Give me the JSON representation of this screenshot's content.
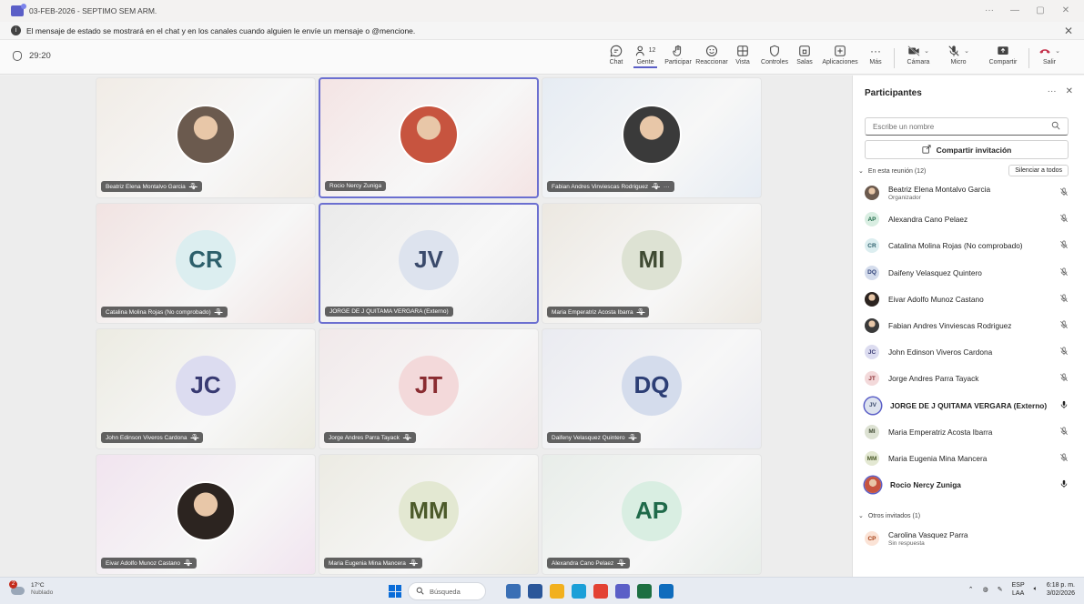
{
  "window": {
    "title": "03-FEB-2026 - SEPTIMO SEM ARM.",
    "controls": [
      "···",
      "—",
      "▢",
      "✕"
    ]
  },
  "notification": {
    "icon": "info-icon",
    "message": "El mensaje de estado se mostrará en el chat y en los canales cuando alguien le envíe un mensaje o @mencione.",
    "close": "✕"
  },
  "toolbar": {
    "timer": "29:20",
    "people_count": "12",
    "buttons": {
      "chat": "Chat",
      "people": "Gente",
      "raise": "Participar",
      "react": "Reaccionar",
      "view": "Vista",
      "controls": "Controles",
      "rooms": "Salas",
      "apps": "Aplicaciones",
      "more": "Más",
      "camera": "Cámara",
      "mic": "Micro",
      "share": "Compartir",
      "leave": "Salir"
    }
  },
  "tiles": [
    {
      "name": "Beatriz Elena Montalvo Garcia",
      "initials": "",
      "photo": true,
      "muted": true,
      "bg": "#f1ece6",
      "avatar_color": "#6b5a4e"
    },
    {
      "name": "Rocio Nercy Zuniga",
      "initials": "",
      "photo": true,
      "muted": false,
      "bg": "#f4e4e4",
      "avatar_color": "#c7543f"
    },
    {
      "name": "Fabian Andres Vinviescas Rodriguez",
      "initials": "",
      "photo": true,
      "muted": true,
      "bg": "#e6ecf3",
      "avatar_color": "#3a3a3a"
    },
    {
      "name": "Catalina Molina Rojas (No comprobado)",
      "initials": "CR",
      "photo": false,
      "muted": true,
      "bg": "#f1e3e2",
      "avatar_color": "#dceef0",
      "text_color": "#2d5f6b"
    },
    {
      "name": "JORGE DE J QUITAMA VERGARA (Externo)",
      "initials": "JV",
      "photo": false,
      "muted": false,
      "bg": "#eaeaea",
      "avatar_color": "#dde3ee",
      "text_color": "#3a4a6b"
    },
    {
      "name": "Maria Emperatriz Acosta Ibarra",
      "initials": "MI",
      "photo": false,
      "muted": true,
      "bg": "#ece8e1",
      "avatar_color": "#dde2d3",
      "text_color": "#3f4a32"
    },
    {
      "name": "John Edinson Viveros Cardona",
      "initials": "JC",
      "photo": false,
      "muted": true,
      "bg": "#ecebe2",
      "avatar_color": "#dcdcf0",
      "text_color": "#383a72"
    },
    {
      "name": "Jorge Andres Parra Tayack",
      "initials": "JT",
      "photo": false,
      "muted": true,
      "bg": "#f1e9ea",
      "avatar_color": "#f3d9da",
      "text_color": "#8a2c31"
    },
    {
      "name": "Daifeny Velasquez Quintero",
      "initials": "DQ",
      "photo": false,
      "muted": true,
      "bg": "#eaebf1",
      "avatar_color": "#d4dcec",
      "text_color": "#2c3e75"
    },
    {
      "name": "Eivar Adolfo Munoz Castano",
      "initials": "",
      "photo": true,
      "muted": true,
      "bg": "#f1e4ef",
      "avatar_color": "#2c2420"
    },
    {
      "name": "Maria Eugenia Mina Mancera",
      "initials": "MM",
      "photo": false,
      "muted": true,
      "bg": "#ecebe3",
      "avatar_color": "#e3e8d2",
      "text_color": "#4c5a2a"
    },
    {
      "name": "Alexandra Cano Pelaez",
      "initials": "AP",
      "photo": false,
      "muted": true,
      "bg": "#e8ede9",
      "avatar_color": "#d9eee2",
      "text_color": "#1f6a4a"
    }
  ],
  "panel": {
    "title": "Participantes",
    "more": "···",
    "close": "✕",
    "search_placeholder": "Escribe un nombre",
    "share_invite": "Compartir invitación",
    "in_meeting_label": "En esta reunión (12)",
    "mute_all": "Silenciar a todos",
    "participants": [
      {
        "name": "Beatriz Elena Montalvo Garcia",
        "sub": "Organizador",
        "initials": "",
        "photo": true,
        "avatar_bg": "#6b5a4e",
        "avatar_fg": "#fff",
        "muted": true,
        "bold": false
      },
      {
        "name": "Alexandra Cano Pelaez",
        "sub": "",
        "initials": "AP",
        "photo": false,
        "avatar_bg": "#d9eee2",
        "avatar_fg": "#1f6a4a",
        "muted": true,
        "bold": false
      },
      {
        "name": "Catalina Molina Rojas (No comprobado)",
        "sub": "",
        "initials": "CR",
        "photo": false,
        "avatar_bg": "#dceef0",
        "avatar_fg": "#2d5f6b",
        "muted": true,
        "bold": false
      },
      {
        "name": "Daifeny Velasquez Quintero",
        "sub": "",
        "initials": "DQ",
        "photo": false,
        "avatar_bg": "#d4dcec",
        "avatar_fg": "#2c3e75",
        "muted": true,
        "bold": false
      },
      {
        "name": "Eivar Adolfo Munoz Castano",
        "sub": "",
        "initials": "",
        "photo": true,
        "avatar_bg": "#2c2420",
        "avatar_fg": "#fff",
        "muted": true,
        "bold": false
      },
      {
        "name": "Fabian Andres Vinviescas Rodriguez",
        "sub": "",
        "initials": "",
        "photo": true,
        "avatar_bg": "#3a3a3a",
        "avatar_fg": "#fff",
        "muted": true,
        "bold": false
      },
      {
        "name": "John Edinson Viveros Cardona",
        "sub": "",
        "initials": "JC",
        "photo": false,
        "avatar_bg": "#dcdcf0",
        "avatar_fg": "#383a72",
        "muted": true,
        "bold": false
      },
      {
        "name": "Jorge Andres Parra Tayack",
        "sub": "",
        "initials": "JT",
        "photo": false,
        "avatar_bg": "#f3d9da",
        "avatar_fg": "#8a2c31",
        "muted": true,
        "bold": false
      },
      {
        "name": "JORGE DE J QUITAMA VERGARA (Externo)",
        "sub": "",
        "initials": "JV",
        "photo": false,
        "avatar_bg": "#dde3ee",
        "avatar_fg": "#3a4a6b",
        "muted": false,
        "bold": true
      },
      {
        "name": "Maria Emperatriz Acosta Ibarra",
        "sub": "",
        "initials": "MI",
        "photo": false,
        "avatar_bg": "#dde2d3",
        "avatar_fg": "#3f4a32",
        "muted": true,
        "bold": false
      },
      {
        "name": "Maria Eugenia Mina Mancera",
        "sub": "",
        "initials": "MM",
        "photo": false,
        "avatar_bg": "#e3e8d2",
        "avatar_fg": "#4c5a2a",
        "muted": true,
        "bold": false
      },
      {
        "name": "Rocio Nercy Zuniga",
        "sub": "",
        "initials": "",
        "photo": true,
        "avatar_bg": "#c7543f",
        "avatar_fg": "#fff",
        "muted": false,
        "bold": true
      }
    ],
    "others_label": "Otros invitados (1)",
    "others": [
      {
        "name": "Carolina Vasquez Parra",
        "sub": "Sin respuesta",
        "initials": "CP",
        "avatar_bg": "#fbe3d6",
        "avatar_fg": "#a33a0f"
      }
    ]
  },
  "taskbar": {
    "weather_temp": "17°C",
    "weather_desc": "Nublado",
    "weather_badge": "2",
    "search": "Búsqueda",
    "lang_top": "ESP",
    "lang_bottom": "LAA",
    "time": "6:18 p. m.",
    "date": "3/02/2026",
    "apps": [
      {
        "name": "files-app-icon",
        "color": "#3a6fb5"
      },
      {
        "name": "store-app-icon",
        "color": "#2b579a"
      },
      {
        "name": "explorer-app-icon",
        "color": "#f2b01e"
      },
      {
        "name": "edge-app-icon",
        "color": "#1b9fd8"
      },
      {
        "name": "chrome-app-icon",
        "color": "#e34234"
      },
      {
        "name": "teams-app-icon",
        "color": "#5b5fc7"
      },
      {
        "name": "excel-app-icon",
        "color": "#1d6f42"
      },
      {
        "name": "outlook-app-icon",
        "color": "#0f6cbd"
      }
    ]
  }
}
